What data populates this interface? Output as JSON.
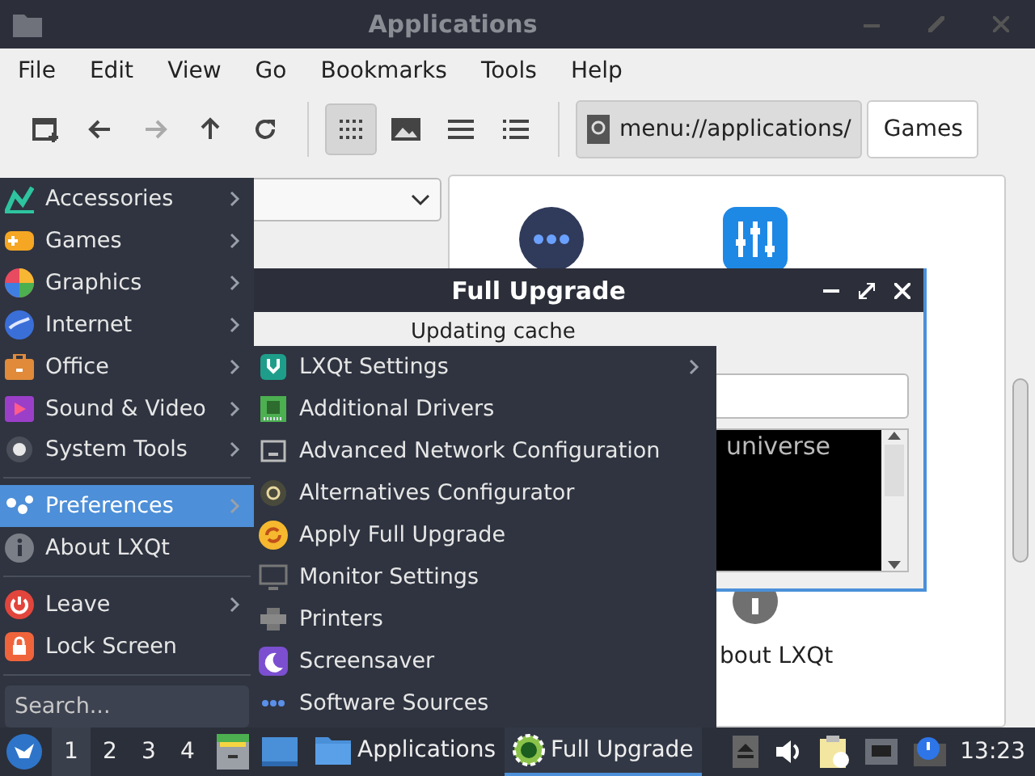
{
  "file_manager": {
    "title": "Applications",
    "menu": [
      "File",
      "Edit",
      "View",
      "Go",
      "Bookmarks",
      "Tools",
      "Help"
    ],
    "nav_buttons": [
      {
        "kind": "new-tab",
        "disabled": false
      },
      {
        "kind": "back",
        "disabled": false
      },
      {
        "kind": "forward",
        "disabled": true
      },
      {
        "kind": "up",
        "disabled": false
      },
      {
        "kind": "reload",
        "disabled": false
      }
    ],
    "view_modes": [
      {
        "kind": "icons",
        "selected": true
      },
      {
        "kind": "thumbnails",
        "selected": false
      },
      {
        "kind": "compact",
        "selected": false
      },
      {
        "kind": "details",
        "selected": false
      }
    ],
    "location": "menu://applications/",
    "path_buttons": [
      "Games"
    ],
    "file_label": "bout LXQt"
  },
  "dialog": {
    "title": "Full Upgrade",
    "status": "Updating cache",
    "log_text": "universe"
  },
  "start_menu": {
    "items": [
      {
        "kind": "item",
        "label": "Accessories",
        "submenu": true,
        "selected": false
      },
      {
        "kind": "item",
        "label": "Games",
        "submenu": true,
        "selected": false
      },
      {
        "kind": "item",
        "label": "Graphics",
        "submenu": true,
        "selected": false
      },
      {
        "kind": "item",
        "label": "Internet",
        "submenu": true,
        "selected": false
      },
      {
        "kind": "item",
        "label": "Office",
        "submenu": true,
        "selected": false
      },
      {
        "kind": "item",
        "label": "Sound & Video",
        "submenu": true,
        "selected": false
      },
      {
        "kind": "item",
        "label": "System Tools",
        "submenu": true,
        "selected": false
      },
      {
        "kind": "separator"
      },
      {
        "kind": "item",
        "label": "Preferences",
        "submenu": true,
        "selected": true
      },
      {
        "kind": "item",
        "label": "About LXQt",
        "submenu": false,
        "selected": false
      },
      {
        "kind": "separator"
      },
      {
        "kind": "item",
        "label": "Leave",
        "submenu": true,
        "selected": false
      },
      {
        "kind": "item",
        "label": "Lock Screen",
        "submenu": false,
        "selected": false
      },
      {
        "kind": "separator"
      }
    ],
    "search": {
      "placeholder": "Search..."
    }
  },
  "submenu": {
    "items": [
      {
        "label": "LXQt Settings",
        "submenu": true
      },
      {
        "label": "Additional Drivers",
        "submenu": false
      },
      {
        "label": "Advanced Network Configuration",
        "submenu": false
      },
      {
        "label": "Alternatives Configurator",
        "submenu": false
      },
      {
        "label": "Apply Full Upgrade",
        "submenu": false
      },
      {
        "label": "Monitor Settings",
        "submenu": false
      },
      {
        "label": "Printers",
        "submenu": false
      },
      {
        "label": "Screensaver",
        "submenu": false
      },
      {
        "label": "Software Sources",
        "submenu": false
      }
    ]
  },
  "taskbar": {
    "desktops": [
      {
        "label": "1",
        "selected": true
      },
      {
        "label": "2",
        "selected": false
      },
      {
        "label": "3",
        "selected": false
      },
      {
        "label": "4",
        "selected": false
      }
    ],
    "tasks": [
      {
        "label": "Applications",
        "selected": false
      },
      {
        "label": "Full Upgrade",
        "selected": true
      }
    ],
    "clock": "13:23"
  }
}
